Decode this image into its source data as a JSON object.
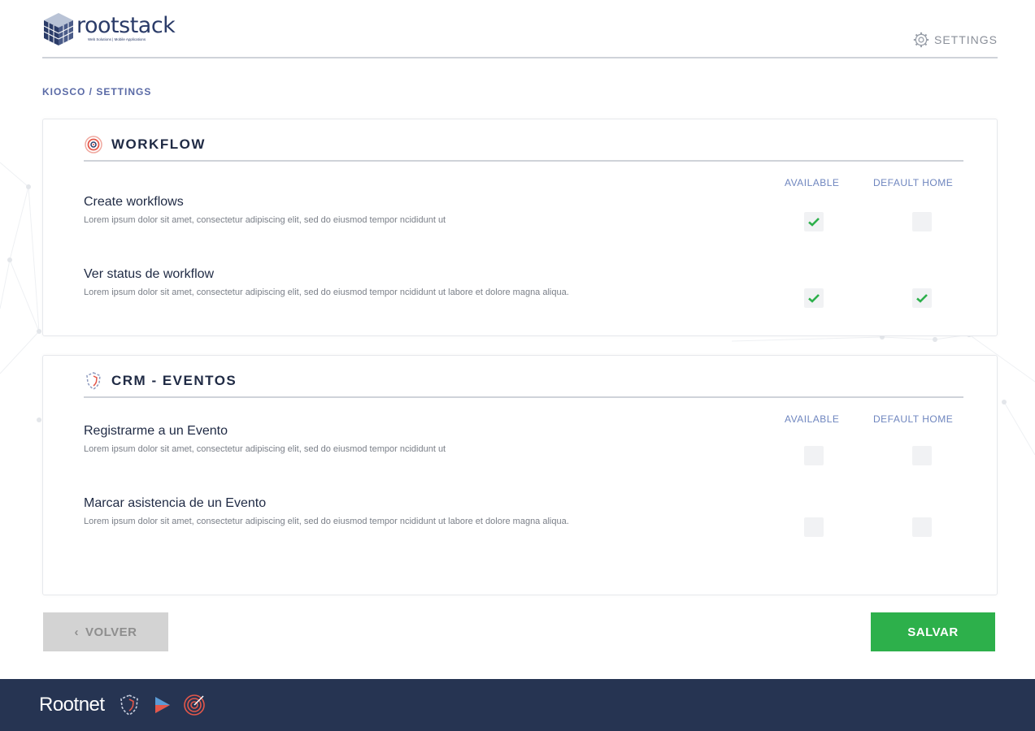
{
  "header": {
    "logo_word": "rootstack",
    "logo_tagline": "Web Solutions | Mobile Applications",
    "settings_label": "SETTINGS"
  },
  "breadcrumb": "KIOSCO / SETTINGS",
  "columns": {
    "available": "AVAILABLE",
    "default_home": "DEFAULT HOME"
  },
  "sections": [
    {
      "title": "WORKFLOW",
      "icon": "target-icon",
      "rows": [
        {
          "title": "Create workflows",
          "description": "Lorem ipsum dolor sit amet, consectetur adipiscing elit, sed do eiusmod tempor ncididunt ut",
          "available": true,
          "default_home": false
        },
        {
          "title": "Ver status de workflow",
          "description": "Lorem ipsum dolor sit amet, consectetur adipiscing elit, sed do eiusmod tempor ncididunt ut labore et dolore magna aliqua.",
          "available": true,
          "default_home": true
        }
      ]
    },
    {
      "title": "CRM - EVENTOS",
      "icon": "shield-icon",
      "rows": [
        {
          "title": "Registrarme a un Evento",
          "description": "Lorem ipsum dolor sit amet, consectetur adipiscing elit, sed do eiusmod tempor ncididunt ut",
          "available": false,
          "default_home": false
        },
        {
          "title": "Marcar asistencia de un Evento",
          "description": "Lorem ipsum dolor sit amet, consectetur adipiscing elit, sed do eiusmod tempor ncididunt ut labore et dolore magna aliqua.",
          "available": false,
          "default_home": false
        }
      ]
    }
  ],
  "buttons": {
    "back": "VOLVER",
    "save": "SALVAR"
  },
  "footer": {
    "brand": "Rootnet"
  },
  "colors": {
    "accent_green": "#2db04b",
    "navy": "#263452",
    "check_green": "#2db04b"
  }
}
